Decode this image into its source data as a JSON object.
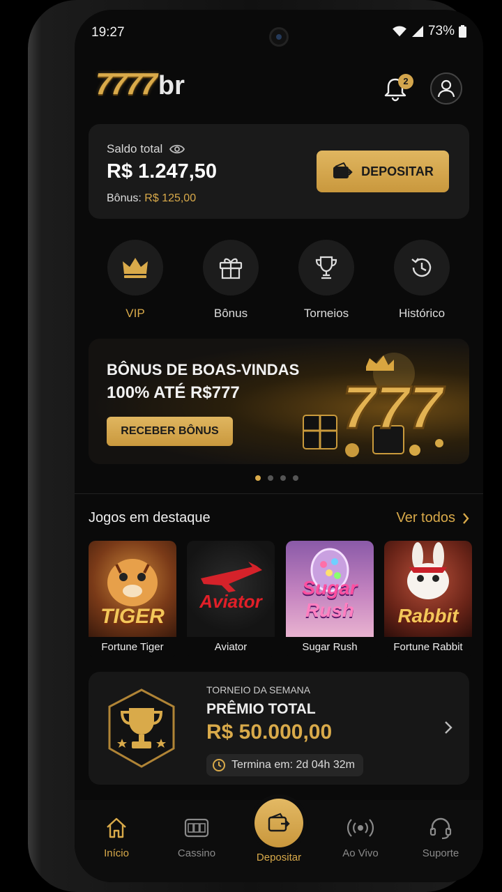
{
  "status_bar": {
    "time": "19:27",
    "battery": "73%"
  },
  "header": {
    "logo_digits": "7777",
    "logo_suffix": "br",
    "notification_count": "2"
  },
  "balance": {
    "label": "Saldo total",
    "value": "R$ 1.247,50",
    "bonus_label": "Bônus:",
    "bonus_value": "R$ 125,00",
    "deposit_label": "DEPOSITAR"
  },
  "quick_actions": [
    {
      "label": "VIP",
      "icon": "crown-icon",
      "color": "#d9aa4a"
    },
    {
      "label": "Bônus",
      "icon": "gift-icon"
    },
    {
      "label": "Torneios",
      "icon": "trophy-icon"
    },
    {
      "label": "Histórico",
      "icon": "history-icon"
    }
  ],
  "banner": {
    "line1": "BÔNUS DE BOAS-VINDAS",
    "line2": "100% ATÉ R$777",
    "button": "RECEBER BÔNUS",
    "art_text": "777",
    "page_count": 4,
    "active_page": 1
  },
  "featured": {
    "title": "Jogos em destaque",
    "see_all": "Ver todos",
    "games": [
      {
        "name": "Fortune Tiger",
        "art_text": "TIGER"
      },
      {
        "name": "Aviator",
        "art_text": "Aviator"
      },
      {
        "name": "Sugar Rush",
        "art_text_1": "Sugar",
        "art_text_2": "Rush"
      },
      {
        "name": "Fortune Rabbit",
        "art_text": "Rabbit"
      }
    ]
  },
  "tournament": {
    "kicker": "TORNEIO DA SEMANA",
    "title": "PRÊMIO TOTAL",
    "value": "R$ 50.000,00",
    "timer": "Termina em: 2d 04h 32m"
  },
  "bottom_nav": {
    "items": [
      {
        "label": "Início",
        "icon": "home-icon",
        "active": true
      },
      {
        "label": "Cassino",
        "icon": "slot-machine-icon"
      },
      {
        "label": "Depositar",
        "icon": "wallet-icon"
      },
      {
        "label": "Ao Vivo",
        "icon": "live-broadcast-icon"
      },
      {
        "label": "Suporte",
        "icon": "headset-icon"
      }
    ]
  },
  "colors": {
    "accent": "#d9aa4a",
    "background": "#0a0a0a",
    "card": "#1a1a1a"
  }
}
